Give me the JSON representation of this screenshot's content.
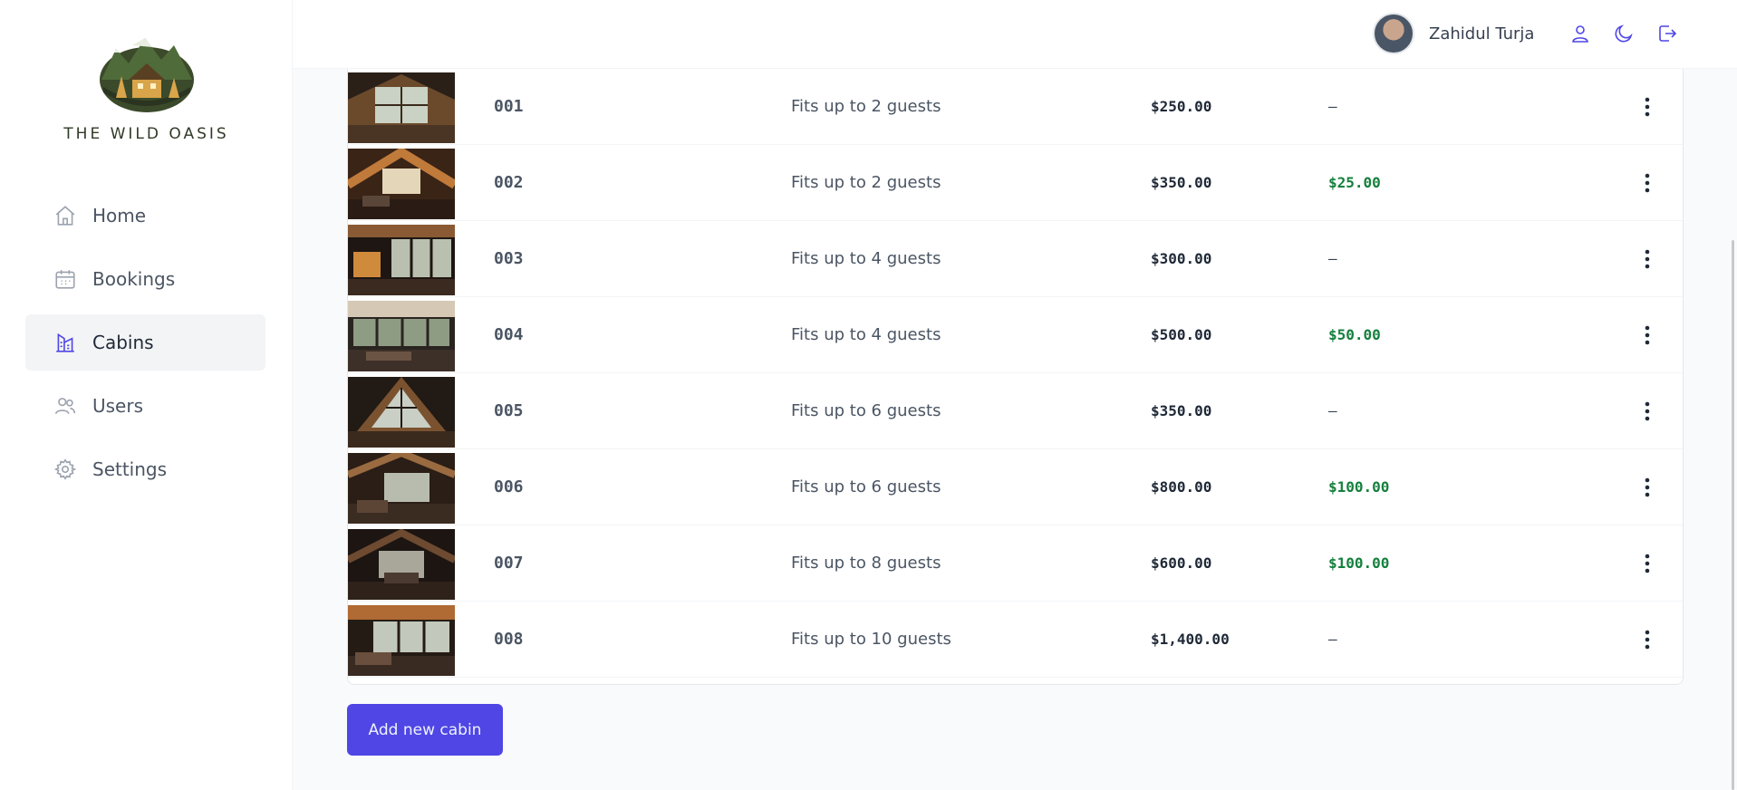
{
  "brand": {
    "name": "THE WILD OASIS"
  },
  "sidebar": {
    "items": [
      {
        "label": "Home",
        "icon": "home-icon",
        "active": false
      },
      {
        "label": "Bookings",
        "icon": "calendar-icon",
        "active": false
      },
      {
        "label": "Cabins",
        "icon": "cabins-icon",
        "active": true
      },
      {
        "label": "Users",
        "icon": "users-icon",
        "active": false
      },
      {
        "label": "Settings",
        "icon": "gear-icon",
        "active": false
      }
    ]
  },
  "header": {
    "user_name": "Zahidul Turja",
    "icons": [
      "user-icon",
      "moon-icon",
      "logout-icon"
    ]
  },
  "cabins": [
    {
      "name": "001",
      "capacity": "Fits up to 2 guests",
      "price": "$250.00",
      "discount": "—"
    },
    {
      "name": "002",
      "capacity": "Fits up to 2 guests",
      "price": "$350.00",
      "discount": "$25.00"
    },
    {
      "name": "003",
      "capacity": "Fits up to 4 guests",
      "price": "$300.00",
      "discount": "—"
    },
    {
      "name": "004",
      "capacity": "Fits up to 4 guests",
      "price": "$500.00",
      "discount": "$50.00"
    },
    {
      "name": "005",
      "capacity": "Fits up to 6 guests",
      "price": "$350.00",
      "discount": "—"
    },
    {
      "name": "006",
      "capacity": "Fits up to 6 guests",
      "price": "$800.00",
      "discount": "$100.00"
    },
    {
      "name": "007",
      "capacity": "Fits up to 8 guests",
      "price": "$600.00",
      "discount": "$100.00"
    },
    {
      "name": "008",
      "capacity": "Fits up to 10 guests",
      "price": "$1,400.00",
      "discount": "—"
    }
  ],
  "actions": {
    "add_label": "Add new cabin"
  },
  "colors": {
    "accent": "#4f46e5",
    "discount": "#15803d",
    "logo_green": "#2f3b26"
  }
}
